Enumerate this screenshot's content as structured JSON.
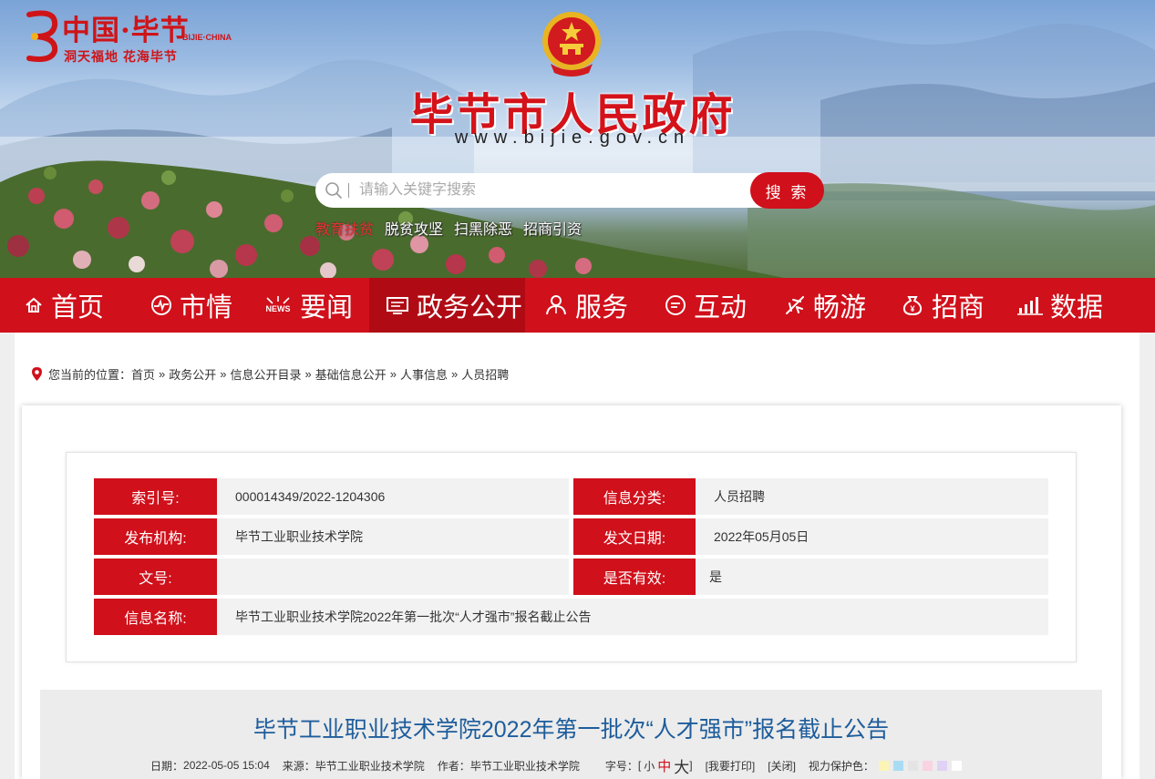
{
  "header": {
    "logo_title": "中国·毕节",
    "logo_english": "BIJIE·CHINA",
    "logo_slogan": "洞天福地  花海毕节",
    "site_title": "毕节市人民政府",
    "site_url": "www.bijie.gov.cn"
  },
  "search": {
    "placeholder": "请输入关键字搜索",
    "button_label": "搜 索"
  },
  "hot_links": [
    "教育扶贫",
    "脱贫攻坚",
    "扫黑除恶",
    "招商引资"
  ],
  "nav": {
    "items": [
      {
        "label": "首页",
        "icon": "home-icon"
      },
      {
        "label": "市情",
        "icon": "pulse-icon"
      },
      {
        "label": "要闻",
        "icon": "news-icon"
      },
      {
        "label": "政务公开",
        "icon": "monitor-icon"
      },
      {
        "label": "服务",
        "icon": "people-icon"
      },
      {
        "label": "互动",
        "icon": "chat-icon"
      },
      {
        "label": "畅游",
        "icon": "plane-icon"
      },
      {
        "label": "招商",
        "icon": "money-bag-icon"
      },
      {
        "label": "数据",
        "icon": "bar-chart-icon"
      }
    ],
    "active_index": 3
  },
  "breadcrumb": {
    "prefix": "您当前的位置：",
    "items": [
      "首页",
      "政务公开",
      "信息公开目录",
      "基础信息公开",
      "人事信息",
      "人员招聘"
    ],
    "separator": "»"
  },
  "info": {
    "index_label": "索引号:",
    "index_value": "000014349/2022-1204306",
    "category_label": "信息分类:",
    "category_value": "人员招聘",
    "publisher_label": "发布机构:",
    "publisher_value": "毕节工业职业技术学院",
    "date_label": "发文日期:",
    "date_value": "2022年05月05日",
    "docno_label": "文号:",
    "docno_value": "",
    "valid_label": "是否有效:",
    "valid_value": "是",
    "name_label": "信息名称:",
    "name_value": "毕节工业职业技术学院2022年第一批次“人才强市”报名截止公告"
  },
  "article": {
    "title": "毕节工业职业技术学院2022年第一批次“人才强市”报名截止公告",
    "date_label": "日期：",
    "date_value": "2022-05-05 15:04",
    "source_label": "来源：",
    "source_value": "毕节工业职业技术学院",
    "author_label": "作者：",
    "author_value": "毕节工业职业技术学院",
    "font_label": "字号：",
    "font_open": "[",
    "font_small": "小",
    "font_mid": "中",
    "font_big": "大",
    "font_close": "]",
    "print_label": "[我要打印]",
    "close_label": "[关闭]",
    "eye_label": "视力保护色：",
    "eye_colors": [
      "#fbf4b5",
      "#a9dcf3",
      "#e4e4e4",
      "#f9d3e2",
      "#e1d1f5",
      "#ffffff"
    ]
  },
  "colors": {
    "brand_red": "#d0101b",
    "nav_active": "#b00b14",
    "title_blue": "#1e5d9c"
  }
}
